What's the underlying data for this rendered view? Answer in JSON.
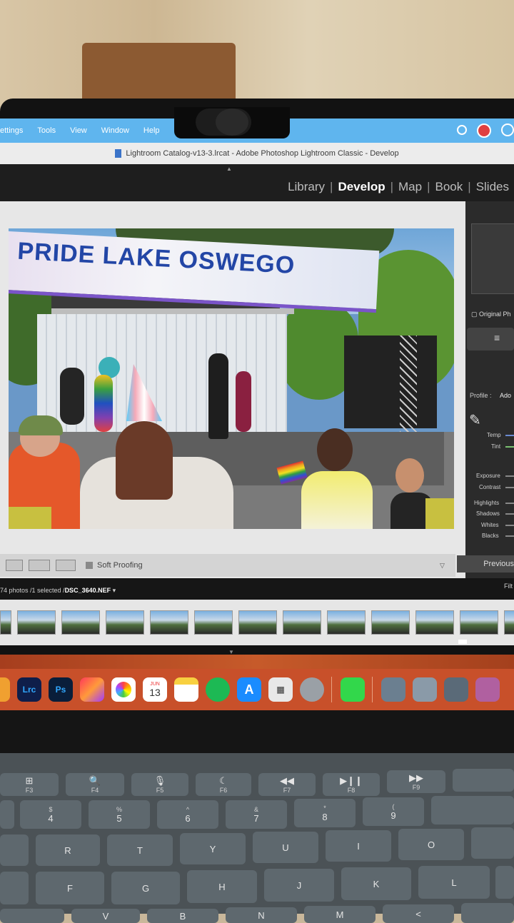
{
  "menubar": {
    "items": [
      "ettings",
      "Tools",
      "View",
      "Window",
      "Help"
    ]
  },
  "window": {
    "title": "Lightroom Catalog-v13-3.lrcat - Adobe Photoshop Lightroom Classic - Develop"
  },
  "modules": {
    "items": [
      {
        "label": "Library",
        "active": false
      },
      {
        "label": "Develop",
        "active": true
      },
      {
        "label": "Map",
        "active": false
      },
      {
        "label": "Book",
        "active": false
      },
      {
        "label": "Slides",
        "active": false
      }
    ],
    "separator": "|"
  },
  "photo": {
    "banner_text": "PRIDE LAKE OSWEGO"
  },
  "toolbar": {
    "soft_proofing_label": "Soft Proofing"
  },
  "right_panel": {
    "original_label": "Original Ph",
    "profile_label": "Profile :",
    "profile_value": "Ado",
    "temp_label": "Temp",
    "tint_label": "Tint",
    "exposure_label": "Exposure",
    "contrast_label": "Contrast",
    "highlights_label": "Highlights",
    "shadows_label": "Shadows",
    "whites_label": "Whites",
    "blacks_label": "Blacks",
    "previous_label": "Previous"
  },
  "filmstrip": {
    "info_prefix": "74 photos /1 selected /",
    "filename": "DSC_3640.NEF",
    "filter_label": "Filt"
  },
  "dock": {
    "calendar_month": "JUN",
    "calendar_day": "13",
    "lrc_label": "Lrc",
    "ps_label": "Ps"
  },
  "keyboard": {
    "function_row": [
      {
        "fn": "F3",
        "glyph": "⊞"
      },
      {
        "fn": "F4",
        "glyph": "🔍"
      },
      {
        "fn": "F5",
        "glyph": "🎙"
      },
      {
        "fn": "F6",
        "glyph": "☾"
      },
      {
        "fn": "F7",
        "glyph": "◀◀"
      },
      {
        "fn": "F8",
        "glyph": "▶❙❙"
      },
      {
        "fn": "F9",
        "glyph": "▶▶"
      }
    ],
    "number_row": [
      {
        "main": "4",
        "alt": "$"
      },
      {
        "main": "5",
        "alt": "%"
      },
      {
        "main": "6",
        "alt": "^"
      },
      {
        "main": "7",
        "alt": "&"
      },
      {
        "main": "8",
        "alt": "*"
      },
      {
        "main": "9",
        "alt": "("
      }
    ],
    "top_letters": [
      "R",
      "T",
      "Y",
      "U",
      "I",
      "O"
    ],
    "home_letters": [
      "F",
      "G",
      "H",
      "J",
      "K",
      "L"
    ],
    "bottom_letters": [
      "V",
      "B",
      "N",
      "M",
      "<"
    ]
  }
}
